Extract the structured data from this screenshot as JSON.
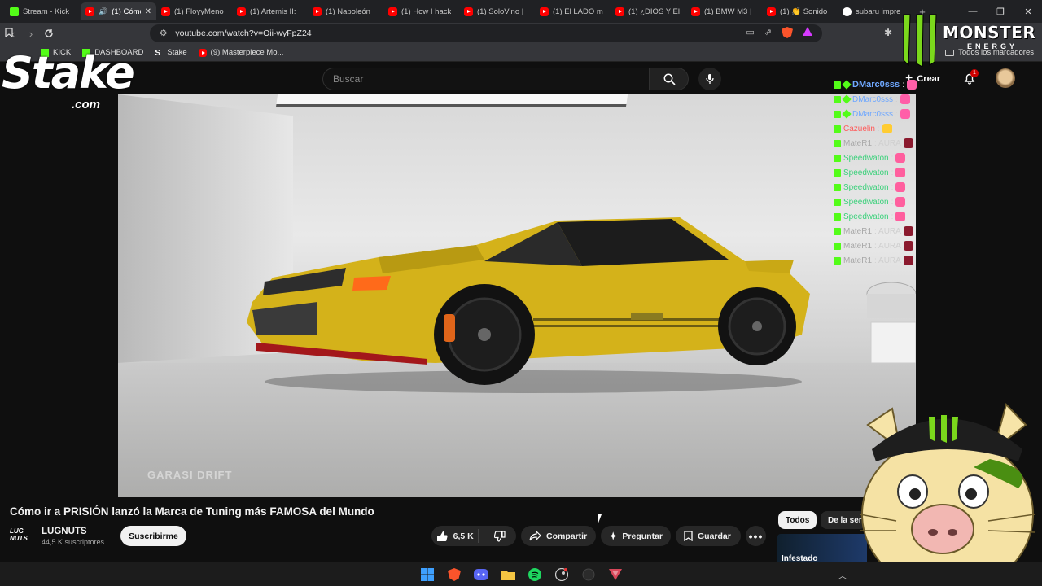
{
  "browser": {
    "tabs": [
      {
        "label": "Stream - Kick",
        "icon": "kick"
      },
      {
        "label": "(1) Cómo",
        "icon": "youtube",
        "active": true
      },
      {
        "label": "(1) FloyyMeno",
        "icon": "youtube"
      },
      {
        "label": "(1) Artemis II:",
        "icon": "youtube"
      },
      {
        "label": "(1) Napoleón",
        "icon": "youtube"
      },
      {
        "label": "(1) How I hack",
        "icon": "youtube"
      },
      {
        "label": "(1) SoloVino |",
        "icon": "youtube"
      },
      {
        "label": "(1) El LADO m",
        "icon": "youtube"
      },
      {
        "label": "(1) ¿DIOS Y El",
        "icon": "youtube"
      },
      {
        "label": "(1) BMW M3 |",
        "icon": "youtube"
      },
      {
        "label": "(1) 👏 Sonido",
        "icon": "youtube"
      },
      {
        "label": "subaru impre",
        "icon": "google"
      }
    ],
    "url": "youtube.com/watch?v=Oii-wyFpZ24",
    "bookmarks": [
      {
        "label": "KICK",
        "icon": "kick"
      },
      {
        "label": "DASHBOARD",
        "icon": "kick"
      },
      {
        "label": "Stake",
        "icon": "stake"
      },
      {
        "label": "(9) Masterpiece Mo...",
        "icon": "youtube"
      }
    ],
    "all_bookmarks": "Todos los marcadores"
  },
  "youtube": {
    "search_placeholder": "Buscar",
    "create_label": "Crear",
    "notification_count": "1",
    "video_title": "Cómo ir a PRISIÓN lanzó la Marca de Tuning más FAMOSA del Mundo",
    "channel_name": "LUGNUTS",
    "channel_logo_text": "LUG NUTS",
    "subscribers": "44,5 K suscriptores",
    "subscribe_label": "Suscribirme",
    "likes": "6,5 K",
    "share_label": "Compartir",
    "ask_label": "Preguntar",
    "save_label": "Guardar",
    "filters": [
      "Todos",
      "De la ser"
    ],
    "video_watermark": "GARASI DRIFT",
    "related_thumb_text": "Infestado"
  },
  "overlay": {
    "stake_logo": "Stake",
    "stake_suffix": ".com",
    "monster_logo": "MONSTER",
    "monster_sub": "ENERGY",
    "chat": [
      {
        "user": "DMarc0sss",
        "text": ":",
        "color": "#6fa8ff",
        "emote": "#ff5fa8"
      },
      {
        "user": "DMarc0sss",
        "text": ":",
        "color": "#6fa8ff",
        "emote": "#ff5fa8"
      },
      {
        "user": "DMarc0sss",
        "text": ":",
        "color": "#6fa8ff",
        "emote": "#ff5fa8"
      },
      {
        "user": "Cazuelin",
        "text": ":",
        "color": "#ff5a5a",
        "emote": "#ffcc33"
      },
      {
        "user": "MateR1",
        "text": ": AURA",
        "color": "#a8a8a8",
        "emote": "#8b1a2e"
      },
      {
        "user": "Speedwaton",
        "text": ":",
        "color": "#3ad17a",
        "emote": "#ff5f9e"
      },
      {
        "user": "Speedwaton",
        "text": ":",
        "color": "#3ad17a",
        "emote": "#ff5f9e"
      },
      {
        "user": "Speedwaton",
        "text": ":",
        "color": "#3ad17a",
        "emote": "#ff5f9e"
      },
      {
        "user": "Speedwaton",
        "text": ":",
        "color": "#3ad17a",
        "emote": "#ff5f9e"
      },
      {
        "user": "Speedwaton",
        "text": ":",
        "color": "#3ad17a",
        "emote": "#ff5f9e"
      },
      {
        "user": "MateR1",
        "text": ": AURA",
        "color": "#a8a8a8",
        "emote": "#8b1a2e"
      },
      {
        "user": "MateR1",
        "text": ": AURA",
        "color": "#a8a8a8",
        "emote": "#8b1a2e"
      },
      {
        "user": "MateR1",
        "text": ": AURA",
        "color": "#a8a8a8",
        "emote": "#8b1a2e"
      }
    ]
  },
  "taskbar": {
    "apps": [
      "windows-start",
      "brave",
      "discord",
      "file-explorer",
      "spotify",
      "steam",
      "obs",
      "brave-nightly"
    ]
  },
  "colors": {
    "youtube_bg": "#0f0f0f",
    "brand_red": "#ff0000",
    "kick_green": "#53fc18",
    "car_gold": "#d4b21a"
  }
}
